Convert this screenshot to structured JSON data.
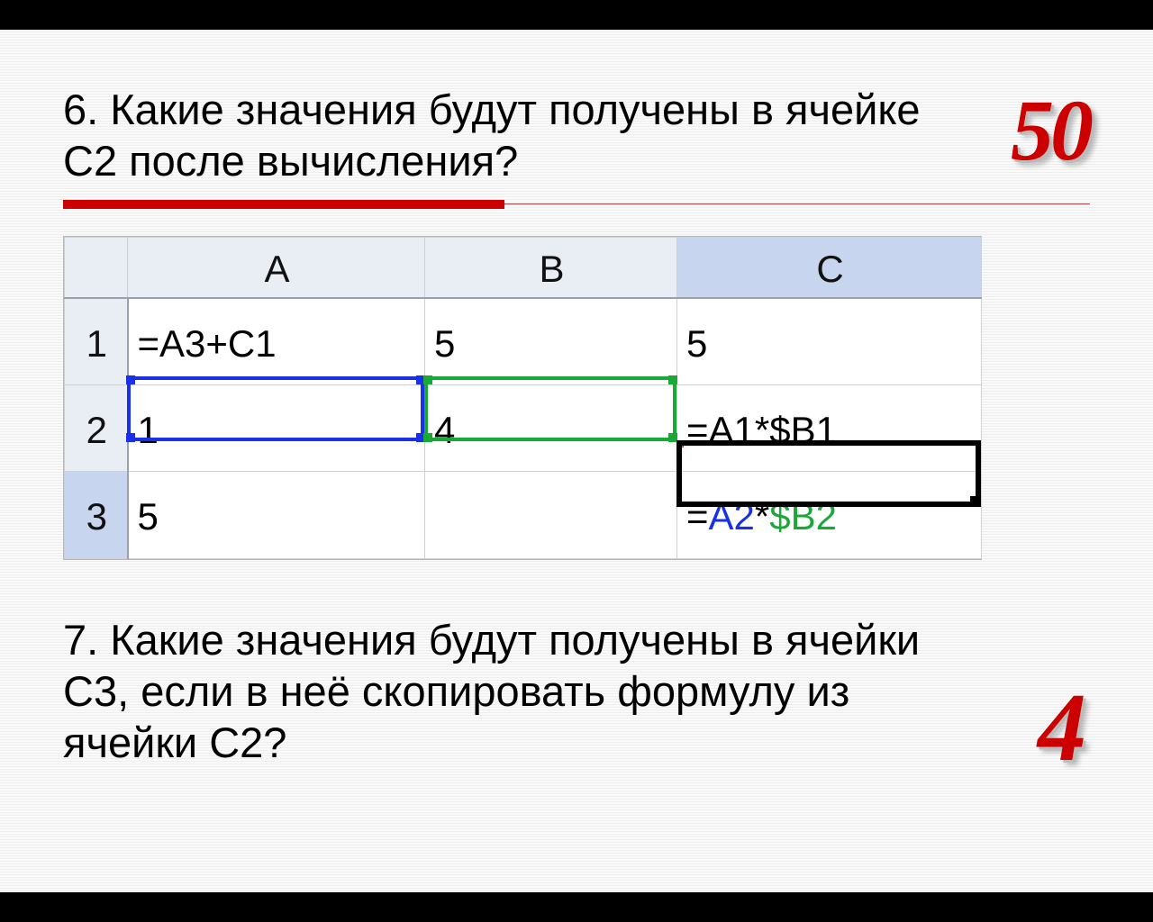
{
  "q6": {
    "text": "6. Какие значения будут получены в ячейке С2 после вычисления?",
    "points": "50"
  },
  "sheet": {
    "headers": {
      "A": "A",
      "B": "B",
      "C": "C"
    },
    "rows": {
      "r1": {
        "num": "1",
        "A": "=A3+C1",
        "B": "5",
        "C": "5"
      },
      "r2": {
        "num": "2",
        "A": "1",
        "B": "4",
        "C": "=A1*$B1"
      },
      "r3": {
        "num": "3",
        "A": "5",
        "B": "",
        "C_eq": "=",
        "C_ref1": "A2",
        "C_op": "*",
        "C_ref2": "$B2"
      }
    }
  },
  "q7": {
    "text": "7. Какие значения будут получены в ячейки С3, если в неё скопировать формулу из ячейки С2?",
    "points": "4"
  }
}
